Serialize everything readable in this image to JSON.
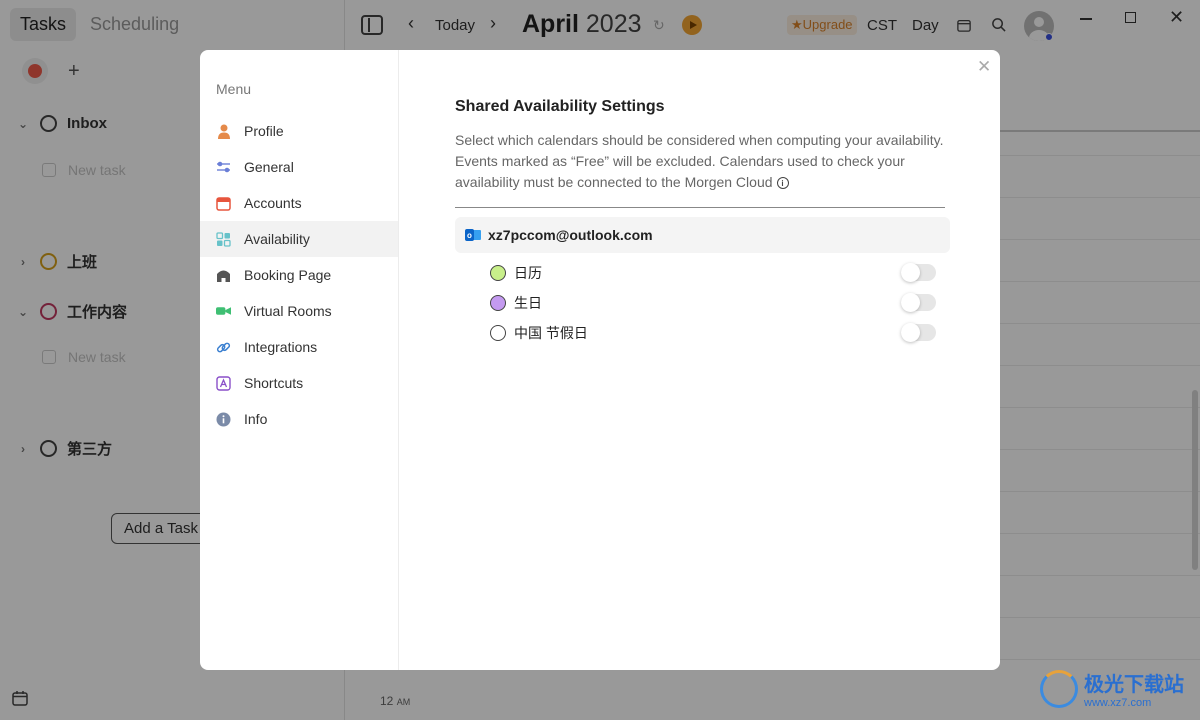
{
  "left_pane": {
    "tabs": [
      {
        "label": "Tasks",
        "active": true
      },
      {
        "label": "Scheduling",
        "active": false
      }
    ],
    "groups": [
      {
        "label": "Inbox",
        "expanded": true,
        "color": "#444444"
      },
      {
        "label": "上班",
        "expanded": false,
        "color": "#d6a11b"
      },
      {
        "label": "工作内容",
        "expanded": true,
        "color": "#c23a62"
      },
      {
        "label": "第三方",
        "expanded": false,
        "color": "#444444"
      }
    ],
    "new_task_placeholder": "New task",
    "add_task_label": "Add a Task"
  },
  "toolbar": {
    "today_label": "Today",
    "month": "April",
    "year": "2023",
    "upgrade_label": "Upgrade",
    "timezone": "CST",
    "view": "Day"
  },
  "time_label": {
    "hour": "12",
    "suffix": "AM"
  },
  "modal": {
    "menu_title": "Menu",
    "menu_items": [
      {
        "label": "Profile",
        "icon": "profile-icon",
        "color": "#e58a4a"
      },
      {
        "label": "General",
        "icon": "sliders-icon",
        "color": "#6b7fd7"
      },
      {
        "label": "Accounts",
        "icon": "calendar-icon",
        "color": "#e7553d"
      },
      {
        "label": "Availability",
        "icon": "grid-icon",
        "color": "#67c2c9",
        "active": true
      },
      {
        "label": "Booking Page",
        "icon": "home-icon",
        "color": "#555555"
      },
      {
        "label": "Virtual Rooms",
        "icon": "video-icon",
        "color": "#3fbf73"
      },
      {
        "label": "Integrations",
        "icon": "link-icon",
        "color": "#3a7fd0"
      },
      {
        "label": "Shortcuts",
        "icon": "shortcut-icon",
        "color": "#8a4fc9"
      },
      {
        "label": "Info",
        "icon": "info-icon",
        "color": "#7b8ba8"
      }
    ],
    "title": "Shared Availability Settings",
    "description": "Select which calendars should be considered when computing your availability. Events marked as “Free” will be excluded. Calendars used to check your availability must be connected to the Morgen Cloud",
    "account": "xz7pccom@outlook.com",
    "calendars": [
      {
        "name": "日历",
        "color": "#c8ef8a",
        "enabled": false
      },
      {
        "name": "生日",
        "color": "#c49af0",
        "enabled": false
      },
      {
        "name": "中国 节假日",
        "color": "#ffffff",
        "enabled": false
      }
    ]
  },
  "watermark": {
    "brand": "极光下载站",
    "url": "www.xz7.com"
  }
}
